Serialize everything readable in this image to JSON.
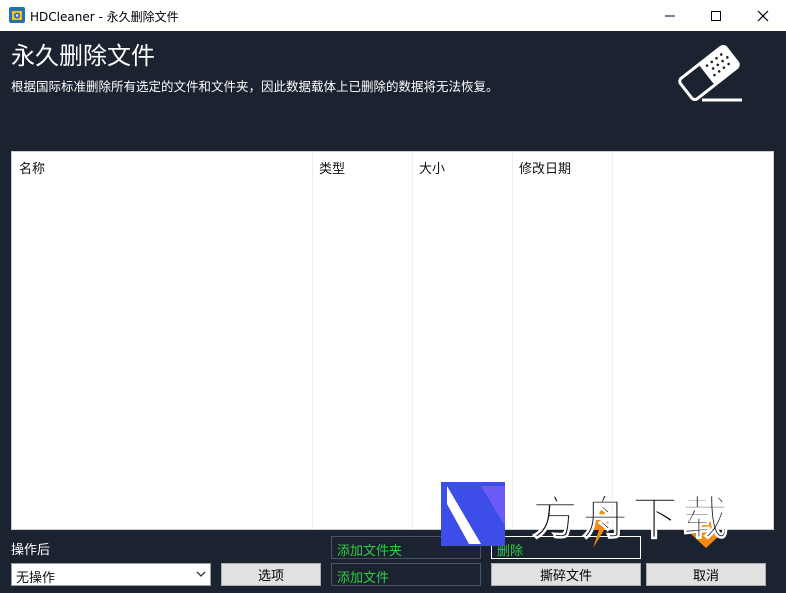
{
  "window": {
    "title": "HDCleaner - 永久删除文件"
  },
  "header": {
    "heading": "永久删除文件",
    "subtitle": "根据国际标准删除所有选定的文件和文件夹，因此数据载体上已删除的数据将无法恢复。"
  },
  "file_list": {
    "columns": [
      "名称",
      "类型",
      "大小",
      "修改日期"
    ]
  },
  "footer": {
    "after_label": "操作后",
    "after_select_value": "无操作",
    "options_button": "选项",
    "add_folder_button": "添加文件夹",
    "add_file_button": "添加文件",
    "delete_button": "删除",
    "shred_button": "撕碎文件",
    "cancel_button": "取消"
  },
  "watermark": {
    "text": "方舟下载"
  },
  "colors": {
    "background": "#1b2230",
    "accent_green": "#33cc44",
    "watermark_blue": "#3d4ee8",
    "watermark_orange": "#f28a12"
  }
}
